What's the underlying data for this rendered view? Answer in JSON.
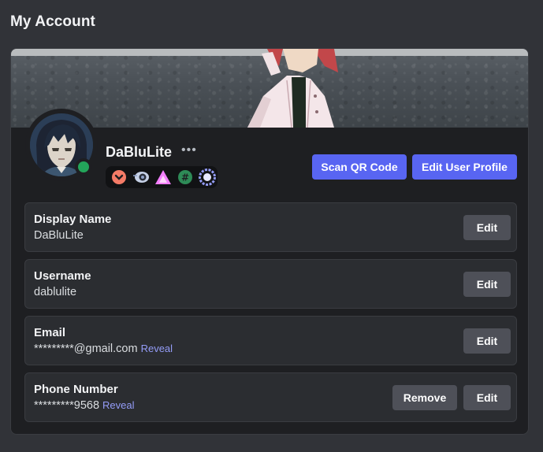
{
  "page": {
    "title": "My Account"
  },
  "profile": {
    "display_username": "DaBluLite",
    "more_icon": "•••",
    "status": "online",
    "status_color": "#23a55a",
    "badges": [
      {
        "icon": "chevron-badge-icon",
        "color": "#f47b67"
      },
      {
        "icon": "hypesquad-eye-badge-icon",
        "color": "#8fa1c8"
      },
      {
        "icon": "triangle-badge-icon",
        "color": "#f47fff"
      },
      {
        "icon": "hashtag-badge-icon",
        "color": "#3ba55c"
      },
      {
        "icon": "gear-badge-icon",
        "color": "#949cf7"
      }
    ]
  },
  "actions": {
    "scan_qr": "Scan QR Code",
    "edit_profile": "Edit User Profile"
  },
  "fields": [
    {
      "label": "Display Name",
      "value": "DaBluLite",
      "reveal": "",
      "edit": "Edit",
      "remove": ""
    },
    {
      "label": "Username",
      "value": "dablulite",
      "reveal": "",
      "edit": "Edit",
      "remove": ""
    },
    {
      "label": "Email",
      "value": "*********@gmail.com",
      "reveal": "Reveal",
      "edit": "Edit",
      "remove": ""
    },
    {
      "label": "Phone Number",
      "value": "*********9568",
      "reveal": "Reveal",
      "edit": "Edit",
      "remove": "Remove"
    }
  ],
  "colors": {
    "background": "#313338",
    "card": "#1e1f22",
    "row": "#2b2d31",
    "primary_button": "#5865f2",
    "secondary_button": "#4e5058",
    "link": "#949cf7"
  }
}
